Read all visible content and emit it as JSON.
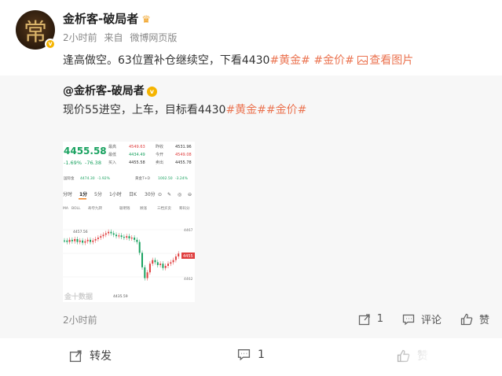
{
  "post": {
    "author": "金析客-破局者",
    "time": "2小时前",
    "source_prefix": "来自",
    "source": "微博网页版",
    "text": "逢高做空。63位置补仓继续空，下看4430",
    "tags": [
      "#黄金#",
      "#金价#"
    ],
    "picture_link": "查看图片",
    "avatar_glyph": "常"
  },
  "repost": {
    "author": "@金析客-破局者",
    "text": "现价55进空，上车，目标看4430",
    "tags": [
      "#黄金#",
      "#金价#"
    ],
    "time": "2小时前",
    "actions": {
      "share_count": "1",
      "comment_label": "评论",
      "like_label": "赞"
    }
  },
  "chart_image": {
    "price": "4455.58",
    "change_pct": "-1.69%",
    "change_abs": "-76.38",
    "fields": [
      {
        "k": "最高",
        "v": "4549.63",
        "k2": "昨收",
        "v2": "4531.96"
      },
      {
        "k": "最低",
        "v": "4434.49",
        "k2": "今开",
        "v2": "4549.08"
      },
      {
        "k": "买入",
        "v": "4455.58",
        "k2": "卖出",
        "v2": "4455.78"
      }
    ],
    "row2": [
      "国际金",
      "4474.30",
      "-1.92%",
      "黄金T+D",
      "1002.50",
      "-3.24%"
    ],
    "periods": [
      "分时",
      "1分",
      "5分",
      "1小时",
      "日K",
      "30分"
    ],
    "indicators": [
      "MA",
      "BOLL",
      "寿夸九转",
      "聪明钱",
      "顾涨",
      "三档买卖",
      "筹码分"
    ],
    "high_label": "4457.56",
    "low_label": "4435.59",
    "price_tag": "4455",
    "axis_top": "4467",
    "axis_mid": "4462",
    "watermark": "金十数据"
  },
  "bottom_bar": {
    "share_label": "转发",
    "comment_count": "1",
    "like_label": "赞"
  }
}
